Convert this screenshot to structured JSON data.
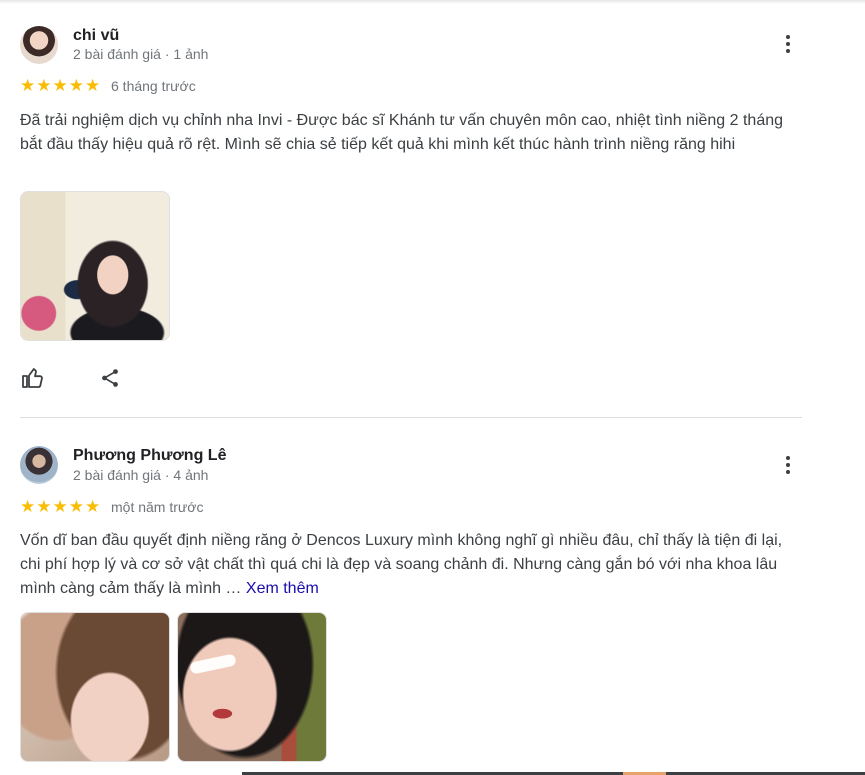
{
  "reviews": [
    {
      "author": "chi vũ",
      "meta": "2 bài đánh giá · 1 ảnh",
      "rating": 5,
      "time": "6 tháng trước",
      "text": "Đã trải nghiệm dịch vụ chỉnh nha Invi - Được bác sĩ Khánh tư vấn chuyên môn cao, nhiệt tình niềng 2 tháng bắt đầu thấy hiệu quả rõ rệt. Mình sẽ chia sẻ tiếp kết quả khi mình kết thúc hành trình niềng răng hihi",
      "photos": 1
    },
    {
      "author": "Phương Phương Lê",
      "meta": "2 bài đánh giá · 4 ảnh",
      "rating": 5,
      "time": "một năm trước",
      "text": "Vốn dĩ ban đầu quyết định niềng răng ở Dencos Luxury mình không nghĩ gì nhiều đâu, chỉ thấy là tiện đi lại, chi phí hợp lý và cơ sở vật chất thì quá chi là đẹp và soang chảnh đi. Nhưng càng gắn bó với nha khoa lâu mình càng cảm thấy là mình …",
      "see_more": "Xem thêm",
      "photos": 2
    }
  ],
  "icons": {
    "star": "star-icon",
    "more": "more-vert-icon",
    "like": "thumb-up-icon",
    "share": "share-icon"
  },
  "colors": {
    "star": "#fbbc04",
    "link": "#1a0dab",
    "meta": "#70757a"
  }
}
